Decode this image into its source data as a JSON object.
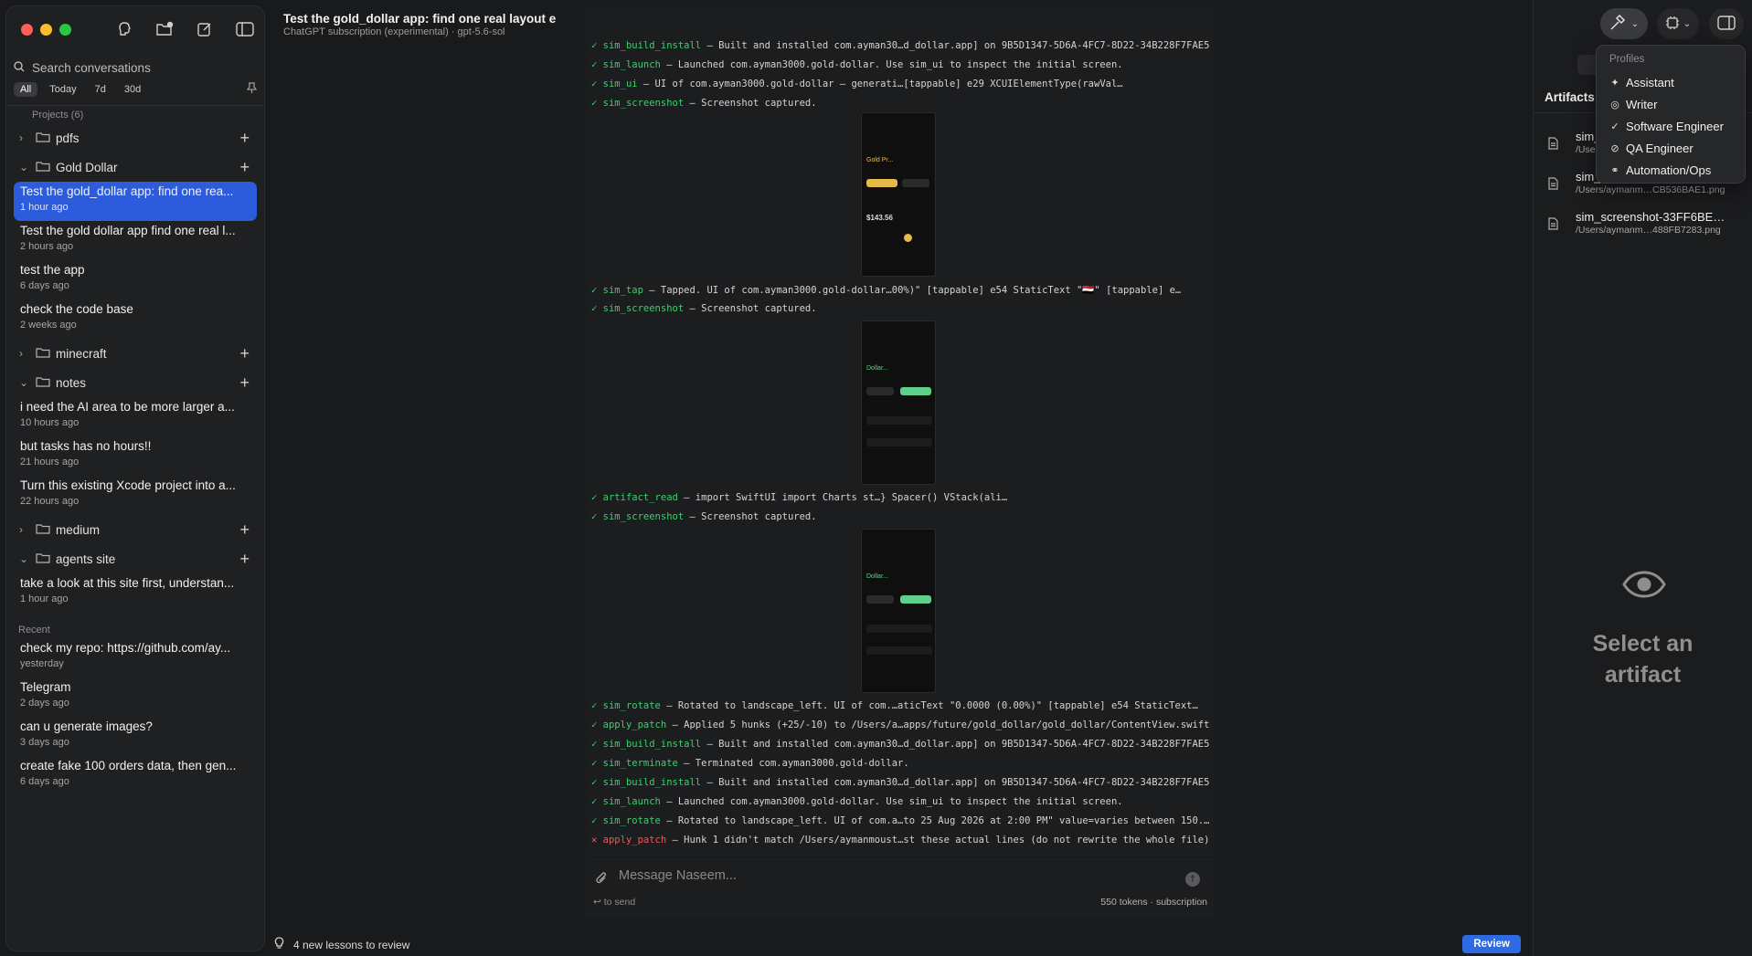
{
  "window": {
    "title": "Test the gold_dollar app: find one real layout e",
    "subtitle": "ChatGPT subscription (experimental) · gpt-5.6-sol"
  },
  "sidebar": {
    "search_placeholder": "Search conversations",
    "filters": [
      "All",
      "Today",
      "7d",
      "30d"
    ],
    "projects_label": "Projects (6)",
    "recent_label": "Recent",
    "folders": [
      {
        "name": "pdfs",
        "expanded": false
      },
      {
        "name": "Gold Dollar",
        "expanded": true
      },
      {
        "name": "minecraft",
        "expanded": false
      },
      {
        "name": "notes",
        "expanded": true
      },
      {
        "name": "medium",
        "expanded": false
      },
      {
        "name": "agents site",
        "expanded": true
      }
    ],
    "gold_dollar_conversations": [
      {
        "title": "Test the gold_dollar app: find one rea...",
        "time": "1 hour ago"
      },
      {
        "title": "Test the gold dollar app find one real l...",
        "time": "2 hours ago"
      },
      {
        "title": "test the app",
        "time": "6 days ago"
      },
      {
        "title": "check the code base",
        "time": "2 weeks ago"
      }
    ],
    "notes_conversations": [
      {
        "title": "i need the AI area to be more larger a...",
        "time": "10 hours ago"
      },
      {
        "title": "but tasks has no hours!!",
        "time": "21 hours ago"
      },
      {
        "title": "Turn this existing Xcode project into a...",
        "time": "22 hours ago"
      }
    ],
    "agents_site_conversations": [
      {
        "title": "take a look at this site first, understan...",
        "time": "1 hour ago"
      }
    ],
    "recent_conversations": [
      {
        "title": "check my repo: https://github.com/ay...",
        "time": "yesterday"
      },
      {
        "title": "Telegram",
        "time": "2 days ago"
      },
      {
        "title": "can u generate images?",
        "time": "3 days ago"
      },
      {
        "title": "create fake 100 orders data, then gen...",
        "time": "6 days ago"
      }
    ]
  },
  "log": [
    {
      "status": "ok",
      "tool": "sim_build_install",
      "text": " — Built and installed com.ayman30…d_dollar.app] on 9B5D1347-5D6A-4FC7-8D22-34B228F7FAE5."
    },
    {
      "status": "ok",
      "tool": "sim_launch",
      "text": " — Launched com.ayman3000.gold-dollar. Use sim_ui to inspect the initial screen."
    },
    {
      "status": "ok",
      "tool": "sim_ui",
      "text": " — UI of com.ayman3000.gold-dollar — generati…[tappable]                e29 XCUIElementType(rawVal…"
    },
    {
      "status": "ok",
      "tool": "sim_screenshot",
      "text": " — Screenshot captured."
    },
    {
      "status": "ok",
      "tool": "sim_tap",
      "text": " — Tapped.  UI of com.ayman3000.gold-dollar…00%)\" [tappable]   e54 StaticText \"🇪🇬\" [tappable]   e…"
    },
    {
      "status": "ok",
      "tool": "sim_screenshot",
      "text": " — Screenshot captured."
    },
    {
      "status": "ok",
      "tool": "artifact_read",
      "text": " — import SwiftUI import Charts  st…}            Spacer()            VStack(ali…"
    },
    {
      "status": "ok",
      "tool": "sim_screenshot",
      "text": " — Screenshot captured."
    },
    {
      "status": "ok",
      "tool": "sim_rotate",
      "text": " — Rotated to landscape_left.  UI of com.…aticText \"0.0000 (0.00%)\" [tappable]   e54 StaticText…"
    },
    {
      "status": "ok",
      "tool": "apply_patch",
      "text": " — Applied 5 hunks (+25/-10) to /Users/a…apps/future/gold_dollar/gold_dollar/ContentView.swift."
    },
    {
      "status": "ok",
      "tool": "sim_build_install",
      "text": " — Built and installed com.ayman30…d_dollar.app] on 9B5D1347-5D6A-4FC7-8D22-34B228F7FAE5."
    },
    {
      "status": "ok",
      "tool": "sim_terminate",
      "text": " — Terminated com.ayman3000.gold-dollar."
    },
    {
      "status": "ok",
      "tool": "sim_build_install",
      "text": " — Built and installed com.ayman30…d_dollar.app] on 9B5D1347-5D6A-4FC7-8D22-34B228F7FAE5."
    },
    {
      "status": "ok",
      "tool": "sim_launch",
      "text": " — Launched com.ayman3000.gold-dollar. Use sim_ui to inspect the initial screen."
    },
    {
      "status": "ok",
      "tool": "sim_rotate",
      "text": " — Rotated to landscape_left.  UI of com.a…to 25 Aug 2026 at 2:00 PM\" value=varies between 150.…"
    },
    {
      "status": "err",
      "tool": "apply_patch",
      "text": " — Hunk 1 didn't match /Users/aymanmoust…st these actual lines (do not rewrite the whole file)."
    }
  ],
  "screenshots": [
    {
      "title": "Gold Pr...",
      "amount": "$143.56"
    },
    {
      "title": "Dollar...",
      "amount": ""
    },
    {
      "title": "Dollar...",
      "amount": ""
    }
  ],
  "composer": {
    "placeholder": "Message Naseem...",
    "hint": "↩ to send",
    "tokens": "550 tokens · subscription"
  },
  "bottom": {
    "lessons": "4 new lessons to review",
    "review": "Review"
  },
  "right_panel": {
    "title": "Artifacts",
    "artifacts": [
      {
        "name": "sim_",
        "path": "/Users"
      },
      {
        "name": "sim_",
        "path": "/Users/aymanm…CB536BAE1.png"
      },
      {
        "name": "sim_screenshot-33FF6BE…",
        "path": "/Users/aymanm…488FB7283.png"
      }
    ],
    "empty_state": "Select an artifact"
  },
  "profiles_menu": {
    "title": "Profiles",
    "items": [
      {
        "label": "Assistant",
        "icon": "sparkle-icon",
        "checked": false
      },
      {
        "label": "Writer",
        "icon": "compass-icon",
        "checked": false
      },
      {
        "label": "Software Engineer",
        "icon": "checkmark-icon",
        "checked": true
      },
      {
        "label": "QA Engineer",
        "icon": "check-circle-icon",
        "checked": false
      },
      {
        "label": "Automation/Ops",
        "icon": "link-icon",
        "checked": false
      }
    ]
  },
  "colors": {
    "accent": "#2c5cdc",
    "success": "#3ecf6d",
    "error": "#ff5252",
    "review_button": "#2d6ae3"
  }
}
